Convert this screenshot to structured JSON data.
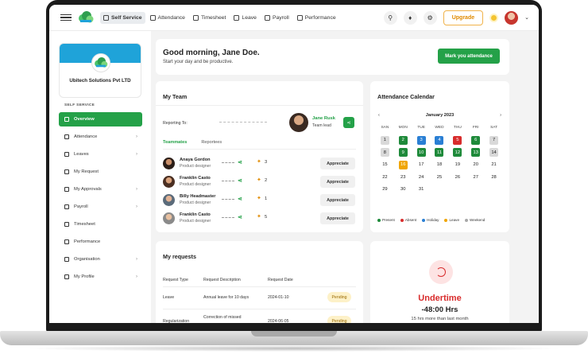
{
  "topbar": {
    "nav": [
      {
        "label": "Self Service",
        "icon": "home-icon"
      },
      {
        "label": "Attendance",
        "icon": "calendar-icon"
      },
      {
        "label": "Timesheet",
        "icon": "timesheet-icon"
      },
      {
        "label": "Leave",
        "icon": "leave-icon"
      },
      {
        "label": "Payroll",
        "icon": "payroll-icon"
      },
      {
        "label": "Performance",
        "icon": "performance-icon"
      }
    ],
    "upgrade_label": "Upgrade"
  },
  "sidebar": {
    "company_name": "Ubitech Solutions Pvt LTD",
    "section_label": "SELF SERVICE",
    "items": [
      {
        "label": "Overview",
        "active": true,
        "chevron": false
      },
      {
        "label": "Attendance",
        "chevron": true
      },
      {
        "label": "Leaves",
        "chevron": true
      },
      {
        "label": "My Request",
        "chevron": false
      },
      {
        "label": "My Approvals",
        "chevron": true
      },
      {
        "label": "Payroll",
        "chevron": true
      },
      {
        "label": "Timesheet",
        "chevron": false
      },
      {
        "label": "Performance",
        "chevron": false
      },
      {
        "label": "Organisation",
        "chevron": true
      },
      {
        "label": "My Profile",
        "chevron": true
      }
    ]
  },
  "greeting": {
    "title": "Good morning, Jane Doe.",
    "subtitle": "Start your day and be productive.",
    "button": "Mark you attendance"
  },
  "team": {
    "title": "My Team",
    "reporting_label": "Reporting To:",
    "lead_name": "Jane Rusk",
    "lead_role": "Team lead",
    "tabs": [
      "Teammates",
      "Reportees"
    ],
    "members": [
      {
        "name": "Anaya Gordon",
        "role": "Product designer",
        "count": "3",
        "button": "Appreciate"
      },
      {
        "name": "Franklin Casto",
        "role": "Product designer",
        "count": "2",
        "button": "Appreciate"
      },
      {
        "name": "Billy Headmaster",
        "role": "Product designer",
        "count": "1",
        "button": "Appreciate"
      },
      {
        "name": "Franklin Casto",
        "role": "Product designer",
        "count": "5",
        "button": "Appreciate"
      }
    ]
  },
  "requests": {
    "title": "My requests",
    "headers": [
      "Request Type",
      "Request Description",
      "Request Date"
    ],
    "rows": [
      {
        "type": "Leave",
        "description": "Annual leave for 10 days",
        "date": "2024-01-10",
        "status": "Pending"
      },
      {
        "type": "Regularization",
        "description": "Correction of missed",
        "date": "2024-06-05",
        "status": "Pending"
      }
    ]
  },
  "calendar": {
    "title": "Attendance Calendar",
    "month": "January 2023",
    "weekdays": [
      "SAN",
      "MON",
      "TUE",
      "WED",
      "THU",
      "FRI",
      "SAT"
    ],
    "days": [
      {
        "d": "1",
        "s": "weekend"
      },
      {
        "d": "2",
        "s": "present"
      },
      {
        "d": "3",
        "s": "holiday"
      },
      {
        "d": "4",
        "s": "holiday"
      },
      {
        "d": "5",
        "s": "absent"
      },
      {
        "d": "6",
        "s": "present"
      },
      {
        "d": "7",
        "s": "weekend"
      },
      {
        "d": "8",
        "s": "weekend"
      },
      {
        "d": "9",
        "s": "present"
      },
      {
        "d": "10",
        "s": "present"
      },
      {
        "d": "11",
        "s": "present"
      },
      {
        "d": "12",
        "s": "present"
      },
      {
        "d": "13",
        "s": "present"
      },
      {
        "d": "14",
        "s": "weekend"
      },
      {
        "d": "15",
        "s": ""
      },
      {
        "d": "16",
        "s": "leave"
      },
      {
        "d": "17",
        "s": ""
      },
      {
        "d": "18",
        "s": ""
      },
      {
        "d": "19",
        "s": ""
      },
      {
        "d": "20",
        "s": ""
      },
      {
        "d": "21",
        "s": ""
      },
      {
        "d": "22",
        "s": ""
      },
      {
        "d": "23",
        "s": ""
      },
      {
        "d": "24",
        "s": ""
      },
      {
        "d": "25",
        "s": ""
      },
      {
        "d": "26",
        "s": ""
      },
      {
        "d": "27",
        "s": ""
      },
      {
        "d": "28",
        "s": ""
      },
      {
        "d": "29",
        "s": ""
      },
      {
        "d": "30",
        "s": ""
      },
      {
        "d": "31",
        "s": ""
      }
    ],
    "legend": [
      {
        "label": "Present",
        "color": "#1e8a3a"
      },
      {
        "label": "Absent",
        "color": "#d82c2c"
      },
      {
        "label": "Holiday",
        "color": "#2a7fd4"
      },
      {
        "label": "Leave",
        "color": "#f0a500"
      },
      {
        "label": "Weekend",
        "color": "#a8a8a8"
      }
    ]
  },
  "undertime": {
    "title": "Undertime",
    "value": "-48:00 Hrs",
    "subtitle": "15 hrs more than last month"
  }
}
